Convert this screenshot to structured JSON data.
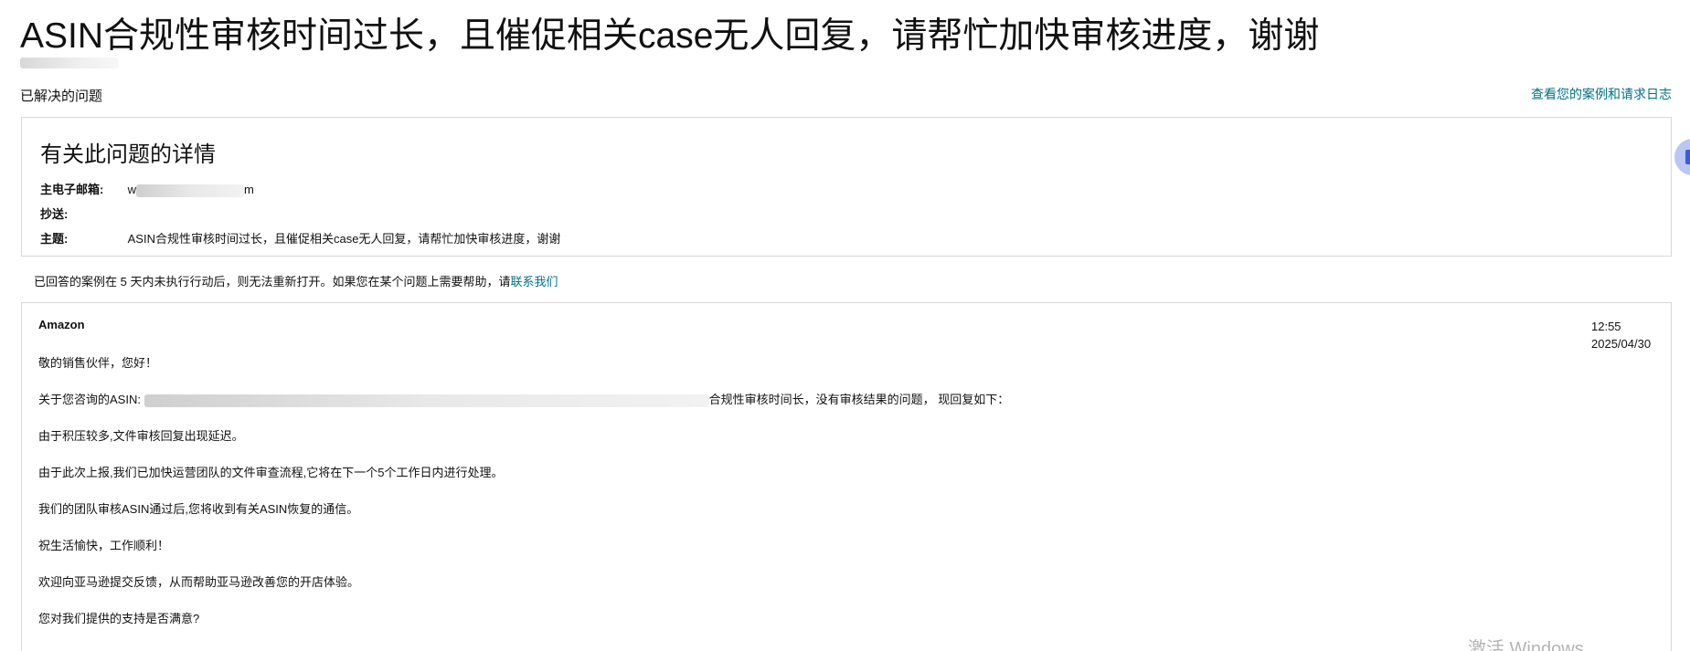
{
  "page": {
    "title": "ASIN合规性审核时间过长，且催促相关case无人回复，请帮忙加快审核进度，谢谢",
    "status": "已解决的问题",
    "case_log_link": "查看您的案例和请求日志"
  },
  "details": {
    "heading": "有关此问题的详情",
    "email_label": "主电子邮箱:",
    "email_value_prefix": "w",
    "email_value_suffix": "m",
    "cc_label": "抄送:",
    "subject_label": "主题:",
    "subject_value": "ASIN合规性审核时间过长，且催促相关case无人回复，请帮忙加快审核进度，谢谢"
  },
  "notice": {
    "text": "已回答的案例在 5 天内未执行行动后，则无法重新打开。如果您在某个问题上需要帮助，请",
    "link": "联系我们"
  },
  "message": {
    "sender": "Amazon",
    "time": "12:55",
    "date": "2025/04/30",
    "greeting": "敬的销售伙伴，您好！",
    "asin_prefix": "关于您咨询的ASIN: ",
    "asin_suffix": "合规性审核时间长，没有审核结果的问题，  现回复如下：",
    "line1": " 由于积压较多,文件审核回复出现延迟。",
    "line2": "由于此次上报,我们已加快运营团队的文件审查流程,它将在下一个5个工作日内进行处理。",
    "line3": "我们的团队审核ASIN通过后,您将收到有关ASIN恢复的通信。",
    "line4": "祝生活愉快，工作顺利！",
    "line5": "欢迎向亚马逊提交反馈，从而帮助亚马逊改善您的开店体验。",
    "line6": "您对我们提供的支持是否满意?"
  },
  "watermark": "激活 Windows",
  "colors": {
    "link": "#007185",
    "border": "#d5d9d9",
    "text": "#111111"
  }
}
